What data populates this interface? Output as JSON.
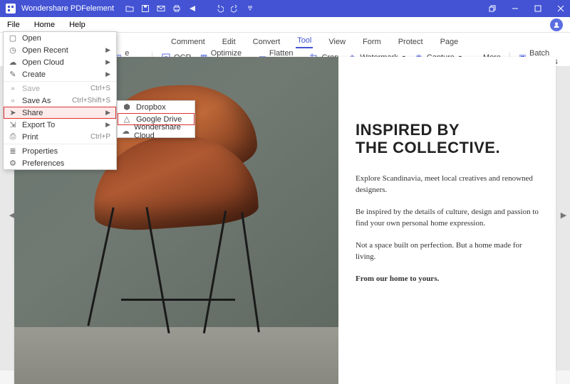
{
  "app": {
    "title": "Wondershare PDFelement"
  },
  "titlebar_icons": [
    "folder",
    "save",
    "email",
    "print",
    "share",
    "undo",
    "redo",
    "dropdown"
  ],
  "menubar": {
    "items": [
      "File",
      "Home",
      "Help"
    ]
  },
  "tabs": {
    "items": [
      "Comment",
      "Edit",
      "Convert",
      "Tool",
      "View",
      "Form",
      "Protect",
      "Page"
    ],
    "active_index": 3
  },
  "toolbar": {
    "items": [
      {
        "icon": "files",
        "label": "e Files"
      },
      {
        "icon": "ocr",
        "label": "OCR"
      },
      {
        "icon": "optimize",
        "label": "Optimize PDF"
      },
      {
        "icon": "flatten",
        "label": "Flatten File"
      },
      {
        "icon": "crop",
        "label": "Crop"
      },
      {
        "icon": "watermark",
        "label": "Watermark"
      },
      {
        "icon": "capture",
        "label": "Capture"
      },
      {
        "icon": "more",
        "label": "More"
      }
    ],
    "right": {
      "icon": "batch",
      "label": "Batch Process"
    }
  },
  "file_menu": [
    {
      "icon": "open",
      "label": "Open"
    },
    {
      "icon": "recent",
      "label": "Open Recent",
      "expand": true
    },
    {
      "icon": "cloud",
      "label": "Open Cloud",
      "expand": true
    },
    {
      "icon": "create",
      "label": "Create",
      "expand": true
    },
    {
      "sep": true
    },
    {
      "icon": "save",
      "label": "Save",
      "shortcut": "Ctrl+S",
      "disabled": true
    },
    {
      "icon": "saveas",
      "label": "Save As",
      "shortcut": "Ctrl+Shift+S"
    },
    {
      "icon": "share",
      "label": "Share",
      "expand": true,
      "highlight": true
    },
    {
      "icon": "export",
      "label": "Export To",
      "expand": true
    },
    {
      "icon": "print",
      "label": "Print",
      "shortcut": "Ctrl+P"
    },
    {
      "sep": true
    },
    {
      "icon": "props",
      "label": "Properties"
    },
    {
      "icon": "prefs",
      "label": "Preferences"
    }
  ],
  "share_submenu": [
    {
      "icon": "dropbox",
      "label": "Dropbox"
    },
    {
      "icon": "gdrive",
      "label": "Google Drive",
      "highlight": true
    },
    {
      "icon": "wscloud",
      "label": "Wondershare Cloud"
    }
  ],
  "document": {
    "heading_line1": "INSPIRED BY",
    "heading_line2": "THE COLLECTIVE.",
    "p1": "Explore Scandinavia, meet local creatives and renowned designers.",
    "p2": "Be inspired by the details of culture, design and passion to find your own personal home expression.",
    "p3": "Not a space built on perfection. But a home made for living.",
    "signoff": "From our home to yours."
  }
}
